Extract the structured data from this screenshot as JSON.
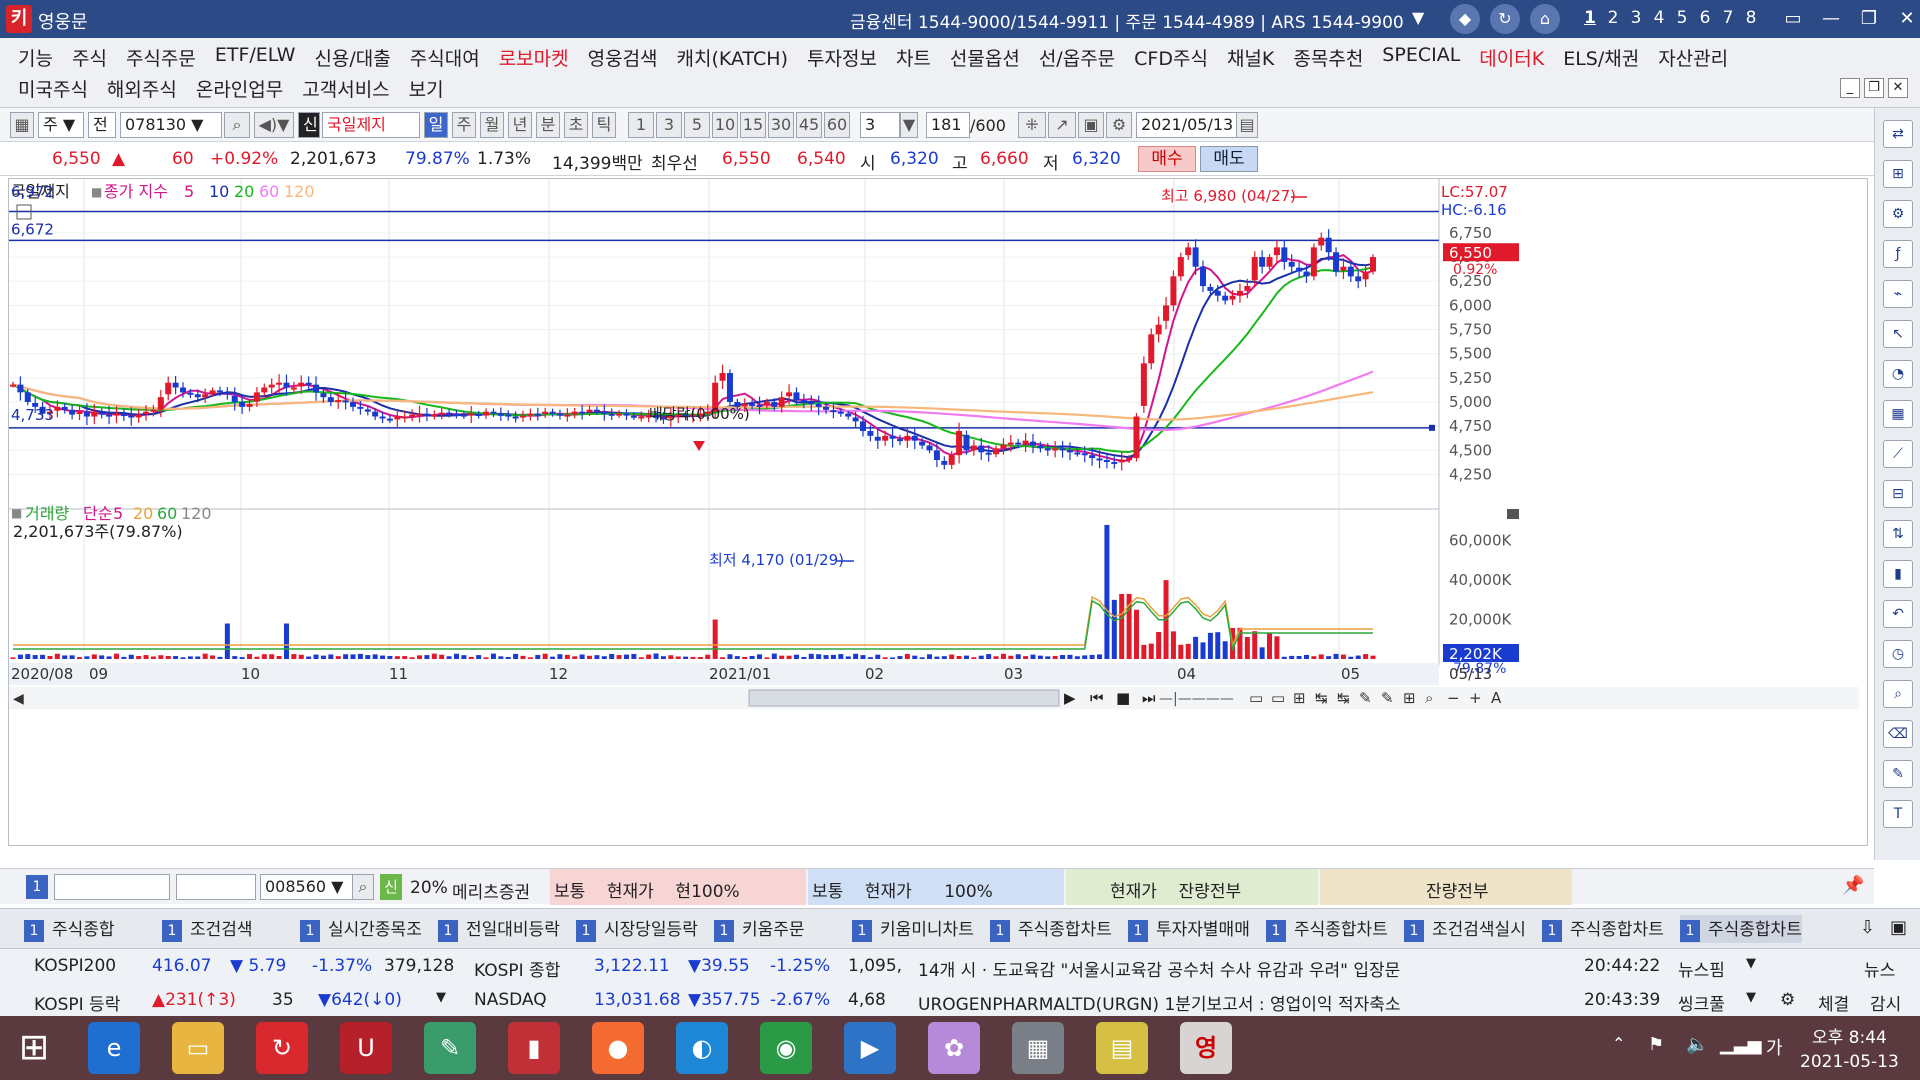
{
  "window": {
    "title": "영웅문",
    "logo": "키"
  },
  "titlebar": {
    "info": "금융센터  1544-9000/1544-9911  |  주문  1544-4989  |  ARS  1544-9900",
    "screen_nums": [
      "1",
      "2",
      "3",
      "4",
      "5",
      "6",
      "7",
      "8"
    ]
  },
  "menu": {
    "row1": [
      {
        "label": "기능"
      },
      {
        "label": "주식"
      },
      {
        "label": "주식주문"
      },
      {
        "label": "ETF/ELW"
      },
      {
        "label": "신용/대출"
      },
      {
        "label": "주식대여"
      },
      {
        "label": "로보마켓",
        "red": true
      },
      {
        "label": "영웅검색"
      },
      {
        "label": "캐치(KATCH)"
      },
      {
        "label": "투자정보"
      },
      {
        "label": "차트"
      },
      {
        "label": "선물옵션"
      },
      {
        "label": "선/옵주문"
      },
      {
        "label": "CFD주식"
      },
      {
        "label": "채널K"
      },
      {
        "label": "종목추천"
      },
      {
        "label": "SPECIAL"
      },
      {
        "label": "데이터K",
        "red": true
      },
      {
        "label": "ELS/채권"
      },
      {
        "label": "자산관리"
      }
    ],
    "row2": [
      {
        "label": "미국주식"
      },
      {
        "label": "해외주식"
      },
      {
        "label": "온라인업무"
      },
      {
        "label": "고객서비스"
      },
      {
        "label": "보기"
      }
    ]
  },
  "toolbar": {
    "type_select": "주",
    "scope": "전",
    "code": "078130",
    "new_badge": "신",
    "stock_name": "국일제지",
    "periods": [
      "일",
      "주",
      "월",
      "년",
      "분",
      "초",
      "틱"
    ],
    "active_period": "일",
    "minute_opts": [
      "1",
      "3",
      "5",
      "10",
      "15",
      "30",
      "45",
      "60"
    ],
    "count_opt": "3",
    "count": "181",
    "max_count": "/600",
    "date": "2021/05/13"
  },
  "quote": {
    "price": "6,550",
    "change": "60",
    "change_pct": "+0.92%",
    "volume": "2,201,673",
    "vol_ratio": "79.87%",
    "turnover": "1.73%",
    "amount": "14,399백만",
    "best_label": "최우선",
    "best_ask": "6,550",
    "best_bid": "6,540",
    "open_label": "시",
    "open": "6,320",
    "high_label": "고",
    "high": "6,660",
    "low_label": "저",
    "low": "6,320",
    "buy_label": "매수",
    "sell_label": "매도"
  },
  "chart_data": {
    "type": "candlestick",
    "title": "국일제지",
    "legend": {
      "series": "종가 지수",
      "periods": [
        "5",
        "10",
        "20",
        "60",
        "120"
      ],
      "colors": [
        "#d4148a",
        "#1a2fa8",
        "#18b818",
        "#f07cf0",
        "#f6b87a"
      ]
    },
    "top_line_label": "6,972",
    "line2_label": "6,672",
    "line3_label": "4,733",
    "annotations": {
      "high": "최고 6,980 (04/27)",
      "low": "최저 4,170 (01/29)",
      "dividend": "배당락(0.00%)"
    },
    "right_labels": {
      "lc": "LC:57.07",
      "hc": "HC:-6.16",
      "price": "6,550",
      "pct": "0.92%"
    },
    "y_ticks": [
      "6,750",
      "6,500",
      "6,250",
      "6,000",
      "5,750",
      "5,500",
      "5,250",
      "5,000",
      "4,750",
      "4,500",
      "4,250"
    ],
    "y_tick_values": [
      6750,
      6500,
      6250,
      6000,
      5750,
      5500,
      5250,
      5000,
      4750,
      4500,
      4250
    ],
    "x_labels": [
      "2020/08",
      "09",
      "10",
      "11",
      "12",
      "2021/01",
      "02",
      "03",
      "04",
      "05",
      "05/13"
    ],
    "close_series": [
      5180,
      5100,
      5000,
      4950,
      4880,
      4900,
      4950,
      4920,
      4870,
      4900,
      4850,
      4900,
      4870,
      4860,
      4880,
      4860,
      4840,
      4870,
      4900,
      4920,
      5050,
      5200,
      5150,
      5100,
      5080,
      5050,
      5080,
      5120,
      5100,
      5080,
      5000,
      4950,
      4980,
      5100,
      5150,
      5180,
      5200,
      5150,
      5150,
      5200,
      5180,
      5100,
      5050,
      5000,
      5020,
      5000,
      4950,
      4930,
      4900,
      4850,
      4830,
      4820,
      4850,
      4850,
      4870,
      4880,
      4860,
      4870,
      4890,
      4880,
      4870,
      4860,
      4880,
      4860,
      4900,
      4880,
      4870,
      4850,
      4840,
      4860,
      4880,
      4870,
      4900,
      4880,
      4860,
      4870,
      4900,
      4890,
      4920,
      4900,
      4880,
      4870,
      4880,
      4860,
      4850,
      4850,
      4860,
      4840,
      4830,
      4860,
      4870,
      4850,
      4870,
      4880,
      4900,
      5200,
      5300,
      5000,
      4950,
      4980,
      4970,
      4960,
      5000,
      4950,
      5050,
      5100,
      5020,
      5000,
      4980,
      4950,
      4920,
      4900,
      4880,
      4850,
      4800,
      4700,
      4650,
      4600,
      4650,
      4620,
      4600,
      4650,
      4600,
      4550,
      4500,
      4400,
      4350,
      4450,
      4700,
      4500,
      4550,
      4480,
      4460,
      4520,
      4560,
      4580,
      4560,
      4600,
      4550,
      4520,
      4500,
      4520,
      4500,
      4480,
      4470,
      4450,
      4420,
      4400,
      4380,
      4370,
      4400,
      4420,
      4850,
      5400,
      5700,
      5800,
      6000,
      6300,
      6500,
      6600,
      6400,
      6200,
      6150,
      6100,
      6050,
      6100,
      6150,
      6200,
      6500,
      6400,
      6500,
      6600,
      6450,
      6400,
      6350,
      6300,
      6600,
      6700,
      6550,
      6350,
      6400,
      6300,
      6250,
      6350,
      6500
    ],
    "volume_legend": {
      "label": "거래량",
      "ma": "단순",
      "periods": [
        "5",
        "20",
        "60",
        "120"
      ]
    },
    "volume_value": "2,201,673주(79.87%)",
    "volume_ticks": [
      "60,000K",
      "40,000K",
      "20,000K"
    ],
    "volume_tick_values": [
      60000,
      40000,
      20000
    ],
    "volume_right": {
      "value": "2,202K",
      "pct": "79.87%"
    }
  },
  "chart_toolbar": {
    "icons": [
      "play-icon",
      "prev-icon",
      "stop-icon",
      "next-icon"
    ]
  },
  "order_strip": {
    "code": "008560",
    "new": "신",
    "rate": "20%",
    "name": "메리츠증권",
    "seg1": "보통    현재가    현100%",
    "seg2": "보통    현재가      100%",
    "seg3": "현재가    잔량전부",
    "seg4": "잔량전부"
  },
  "tabs": [
    {
      "num": "1",
      "label": "주식종합"
    },
    {
      "num": "1",
      "label": "조건검색"
    },
    {
      "num": "1",
      "label": "실시간종목조"
    },
    {
      "num": "1",
      "label": "전일대비등락"
    },
    {
      "num": "1",
      "label": "시장당일등락"
    },
    {
      "num": "1",
      "label": "키움주문"
    },
    {
      "num": "1",
      "label": "키움미니차트"
    },
    {
      "num": "1",
      "label": "주식종합차트"
    },
    {
      "num": "1",
      "label": "투자자별매매"
    },
    {
      "num": "1",
      "label": "주식종합차트"
    },
    {
      "num": "1",
      "label": "조건검색실시"
    },
    {
      "num": "1",
      "label": "주식종합차트"
    },
    {
      "num": "1",
      "label": "주식종합차트"
    }
  ],
  "ticker": {
    "r1": {
      "idx": "KOSPI200",
      "val": "416.07",
      "chg": "▼ 5.79",
      "pct": "-1.37%",
      "vol": "379,128",
      "idx2": "KOSPI 종합",
      "val2": "3,122.11",
      "chg2": "▼39.55",
      "pct2": "-1.25%",
      "vol2": "1,095,",
      "news": "14개 시 · 도교육감 \"서울시교육감 공수처 수사 유감과 우려\" 입장문",
      "time": "20:44:22",
      "src": "뉴스핌",
      "tag": "뉴스"
    },
    "r2": {
      "idx": "KOSPI 등락",
      "up": "▲231(↑3)",
      "flat": "35",
      "down": "▼642(↓0)",
      "idx2": "NASDAQ",
      "val2": "13,031.68",
      "chg2": "▼357.75",
      "pct2": "-2.67%",
      "vol2": "4,68",
      "news": "UROGENPHARMALTD(URGN) 1분기보고서 : 영업이익 적자축소",
      "time": "20:43:39",
      "src": "씽크풀",
      "tag1": "체결",
      "tag2": "감시"
    }
  },
  "taskbar": {
    "time": "오후 8:44",
    "date": "2021-05-13",
    "ime": "가"
  }
}
